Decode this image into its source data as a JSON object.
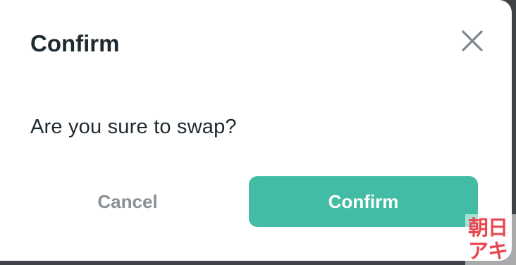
{
  "dialog": {
    "title": "Confirm",
    "message": "Are you sure to swap?",
    "cancel_label": "Cancel",
    "confirm_label": "Confirm",
    "close_icon": "close-icon"
  },
  "watermark": {
    "line1": "朝日",
    "line2": "アキ"
  },
  "colors": {
    "accent": "#43bca6",
    "title_text": "#1f2a30",
    "cancel_text": "#8a9196",
    "close_icon": "#7d868c",
    "backdrop": "#3f4347",
    "watermark": "#e8484f"
  }
}
